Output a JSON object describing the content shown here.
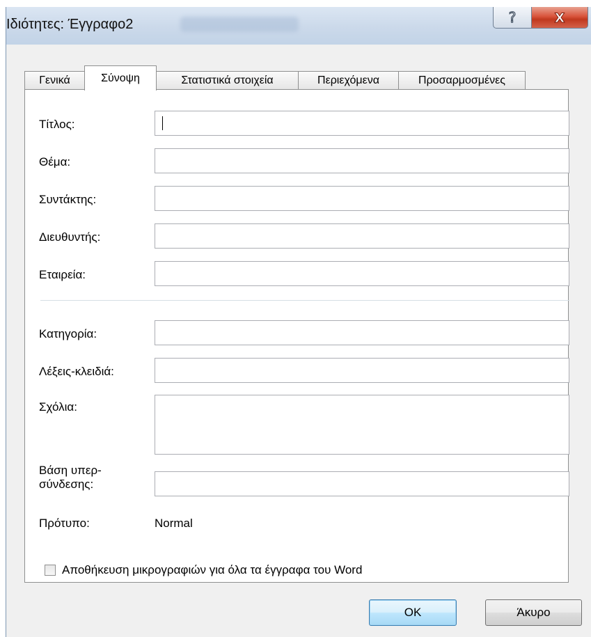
{
  "window": {
    "title": "Ιδιότητες: Έγγραφο2",
    "help_symbol": "?",
    "close_symbol": "X"
  },
  "tabs": [
    {
      "label": "Γενικά",
      "active": false
    },
    {
      "label": "Σύνοψη",
      "active": true
    },
    {
      "label": "Στατιστικά στοιχεία",
      "active": false
    },
    {
      "label": "Περιεχόμενα",
      "active": false
    },
    {
      "label": "Προσαρμοσμένες",
      "active": false
    }
  ],
  "fields": {
    "title": {
      "label": "Τίτλος:",
      "value": ""
    },
    "subject": {
      "label": "Θέμα:",
      "value": ""
    },
    "author": {
      "label": "Συντάκτης:",
      "value": ""
    },
    "manager": {
      "label": "Διευθυντής:",
      "value": ""
    },
    "company": {
      "label": "Εταιρεία:",
      "value": ""
    },
    "category": {
      "label": "Κατηγορία:",
      "value": ""
    },
    "keywords": {
      "label": "Λέξεις-κλειδιά:",
      "value": ""
    },
    "comments": {
      "label": "Σχόλια:",
      "value": ""
    },
    "hyperlink_base": {
      "label": "Βάση υπερ-σύνδεσης:",
      "value": ""
    }
  },
  "template": {
    "label": "Πρότυπο:",
    "value": "Normal"
  },
  "save_thumbnails": {
    "label": "Αποθήκευση μικρογραφιών για όλα τα έγγραφα του Word",
    "checked": false
  },
  "buttons": {
    "ok": "OK",
    "cancel": "Άκυρο"
  },
  "colors": {
    "default_button_border": "#3c7fb1",
    "close_button": "#c0391f"
  }
}
